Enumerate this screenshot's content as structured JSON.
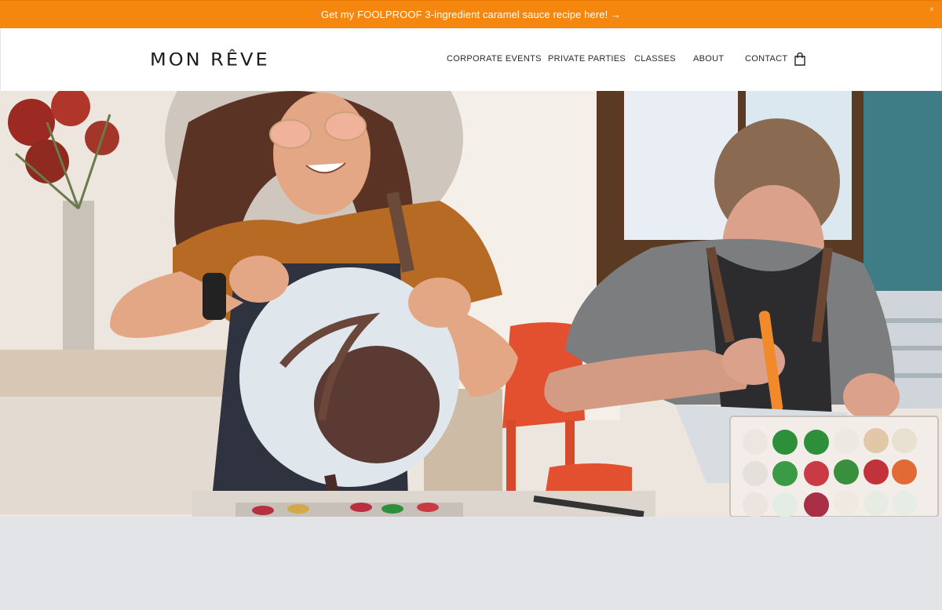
{
  "announcement": {
    "text": "Get my FOOLPROOF 3-ingredient caramel sauce recipe here! →",
    "close_glyph": "×"
  },
  "header": {
    "logo": "MON RÊVE",
    "nav": [
      {
        "label": "CORPORATE EVENTS"
      },
      {
        "label": "PRIVATE PARTIES"
      },
      {
        "label": "CLASSES"
      },
      {
        "label": "ABOUT"
      },
      {
        "label": "CONTACT"
      }
    ],
    "cart_icon": "shopping-bag-icon"
  },
  "hero": {
    "image_alt": "Two women making chocolates in a class"
  },
  "colors": {
    "announcement_bg": "#f5870f",
    "below_hero_bg": "#e2e4e7"
  }
}
